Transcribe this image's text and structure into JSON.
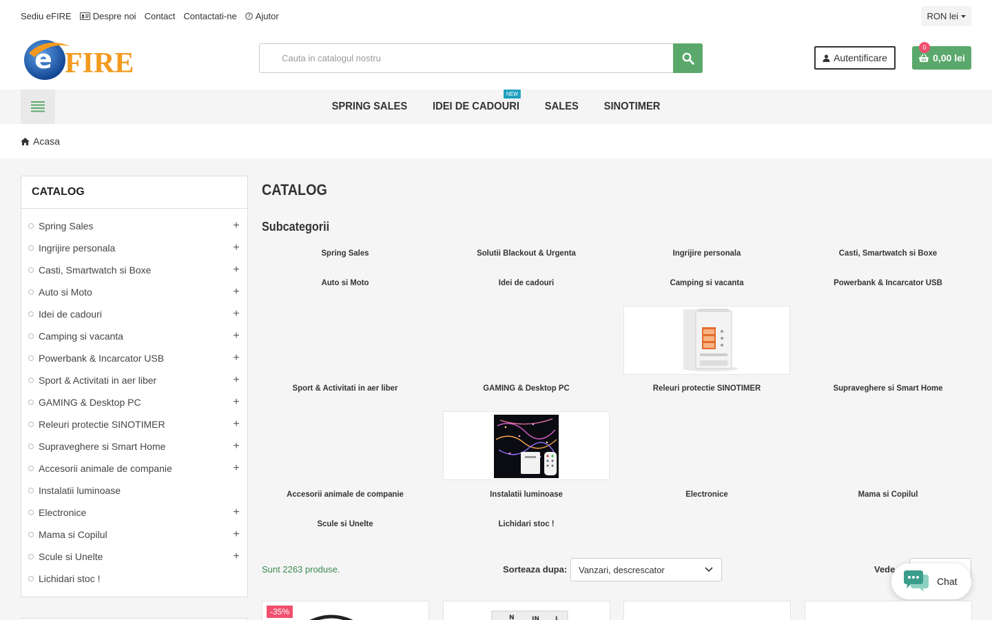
{
  "topbar": {
    "links": [
      "Sediu eFIRE",
      "Despre noi",
      "Contact",
      "Contactati-ne",
      "Ajutor"
    ],
    "currency": "RON lei"
  },
  "header": {
    "logo_text": "eFIRE",
    "search_placeholder": "Cauta in catalogul nostru",
    "login_label": "Autentificare",
    "cart_count": "0",
    "cart_total": "0,00 lei"
  },
  "nav": {
    "items": [
      "SPRING SALES",
      "IDEI DE CADOURI",
      "SALES",
      "SINOTIMER"
    ],
    "new_badge": "NEW"
  },
  "breadcrumb": {
    "home": "Acasa"
  },
  "sidebar": {
    "title": "CATALOG",
    "items": [
      {
        "label": "Spring Sales",
        "expandable": true
      },
      {
        "label": "Ingrijire personala",
        "expandable": true
      },
      {
        "label": "Casti, Smartwatch si Boxe",
        "expandable": true
      },
      {
        "label": "Auto si Moto",
        "expandable": true
      },
      {
        "label": "Idei de cadouri",
        "expandable": true
      },
      {
        "label": "Camping si vacanta",
        "expandable": true
      },
      {
        "label": "Powerbank & Incarcator USB",
        "expandable": true
      },
      {
        "label": "Sport & Activitati in aer liber",
        "expandable": true
      },
      {
        "label": "GAMING & Desktop PC",
        "expandable": true
      },
      {
        "label": "Releuri protectie SINOTIMER",
        "expandable": true
      },
      {
        "label": "Supraveghere si Smart Home",
        "expandable": true
      },
      {
        "label": "Accesorii animale de companie",
        "expandable": true
      },
      {
        "label": "Instalatii luminoase",
        "expandable": false
      },
      {
        "label": "Electronice",
        "expandable": true
      },
      {
        "label": "Mama si Copilul",
        "expandable": true
      },
      {
        "label": "Scule si Unelte",
        "expandable": true
      },
      {
        "label": "Lichidari stoc !",
        "expandable": false
      }
    ]
  },
  "main": {
    "title": "CATALOG",
    "subcategories_title": "Subcategorii",
    "subcategories": [
      "Spring Sales",
      "Solutii Blackout & Urgenta",
      "Ingrijire personala",
      "Casti, Smartwatch si Boxe",
      "Auto si Moto",
      "Idei de cadouri",
      "Camping si vacanta",
      "Powerbank & Incarcator USB",
      "Sport & Activitati in aer liber",
      "GAMING & Desktop PC",
      "Releuri protectie SINOTIMER",
      "Supraveghere si Smart Home",
      "Accesorii animale de companie",
      "Instalatii luminoase",
      "Electronice",
      "Mama si Copilul",
      "Scule si Unelte",
      "Lichidari stoc !"
    ],
    "product_count": "Sunt 2263 produse.",
    "sort_label": "Sorteaza dupa:",
    "sort_value": "Vanzari, descrescator",
    "view_label": "Vede",
    "discount_badge": "-35%"
  },
  "chat": {
    "label": "Chat"
  },
  "colors": {
    "accent": "#5aa86b",
    "badge": "#f0506e",
    "new": "#1f9fbf"
  }
}
